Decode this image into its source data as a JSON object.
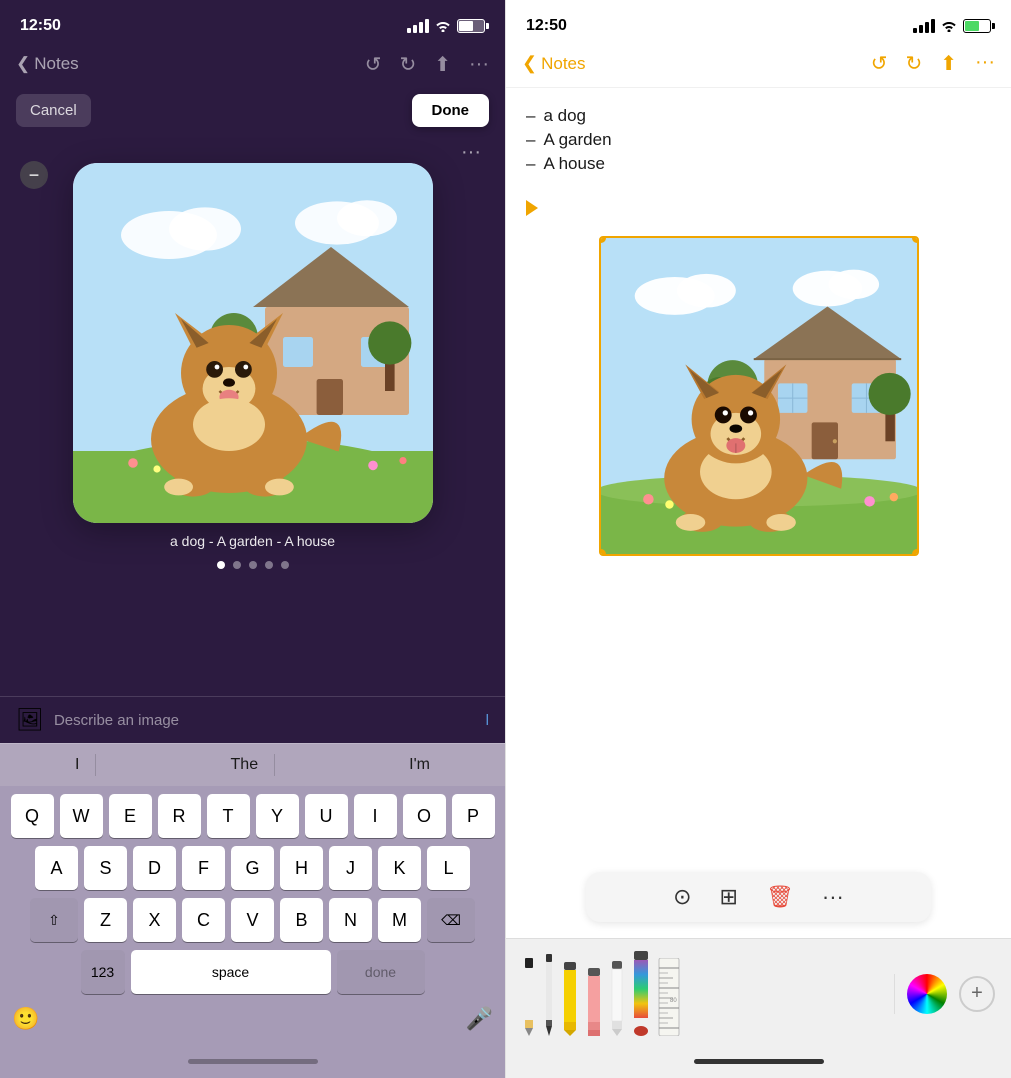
{
  "left": {
    "status": {
      "time": "12:50"
    },
    "nav": {
      "back_label": "Notes",
      "actions": [
        "undo",
        "redo",
        "share",
        "more"
      ]
    },
    "cancel_label": "Cancel",
    "done_label": "Done",
    "image_caption": "a dog - A garden - A house",
    "dots": [
      true,
      false,
      false,
      false,
      false
    ],
    "describe_placeholder": "Describe an image",
    "describe_link": "l",
    "predictive": [
      "I",
      "The",
      "I'm"
    ],
    "keyboard": {
      "row1": [
        "Q",
        "W",
        "E",
        "R",
        "T",
        "Y",
        "U",
        "I",
        "O",
        "P"
      ],
      "row2": [
        "A",
        "S",
        "D",
        "F",
        "G",
        "H",
        "J",
        "K",
        "L"
      ],
      "row3": [
        "Z",
        "X",
        "C",
        "V",
        "B",
        "N",
        "M"
      ],
      "bottom": [
        "123",
        "space",
        "done"
      ]
    }
  },
  "right": {
    "status": {
      "time": "12:50"
    },
    "nav": {
      "back_label": "Notes",
      "title": "Notes"
    },
    "note": {
      "items": [
        "a dog",
        "A garden",
        "A house"
      ]
    },
    "image_toolbar": {
      "icons": [
        "viewfinder",
        "add-frame",
        "trash",
        "more"
      ]
    },
    "drawing_tools": {
      "tools": [
        "pencil",
        "pen",
        "marker-yellow",
        "eraser",
        "white-tool",
        "gradient-pen",
        "ruler"
      ]
    }
  }
}
